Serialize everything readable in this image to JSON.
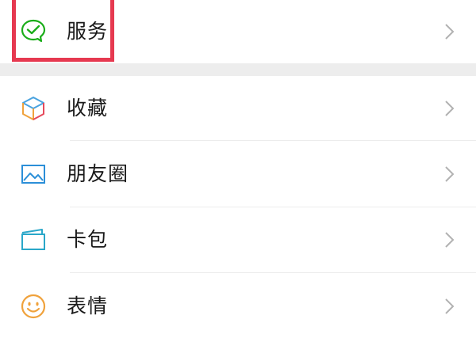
{
  "menu": {
    "items": [
      {
        "label": "服务",
        "icon": "wechat-pay-service-icon"
      },
      {
        "label": "收藏",
        "icon": "favorites-cube-icon"
      },
      {
        "label": "朋友圈",
        "icon": "moments-picture-icon"
      },
      {
        "label": "卡包",
        "icon": "card-wallet-icon"
      },
      {
        "label": "表情",
        "icon": "emoji-smile-icon"
      }
    ]
  },
  "colors": {
    "highlight": "#e63950",
    "service_green": "#1aad19",
    "chevron": "#b2b2b2"
  }
}
